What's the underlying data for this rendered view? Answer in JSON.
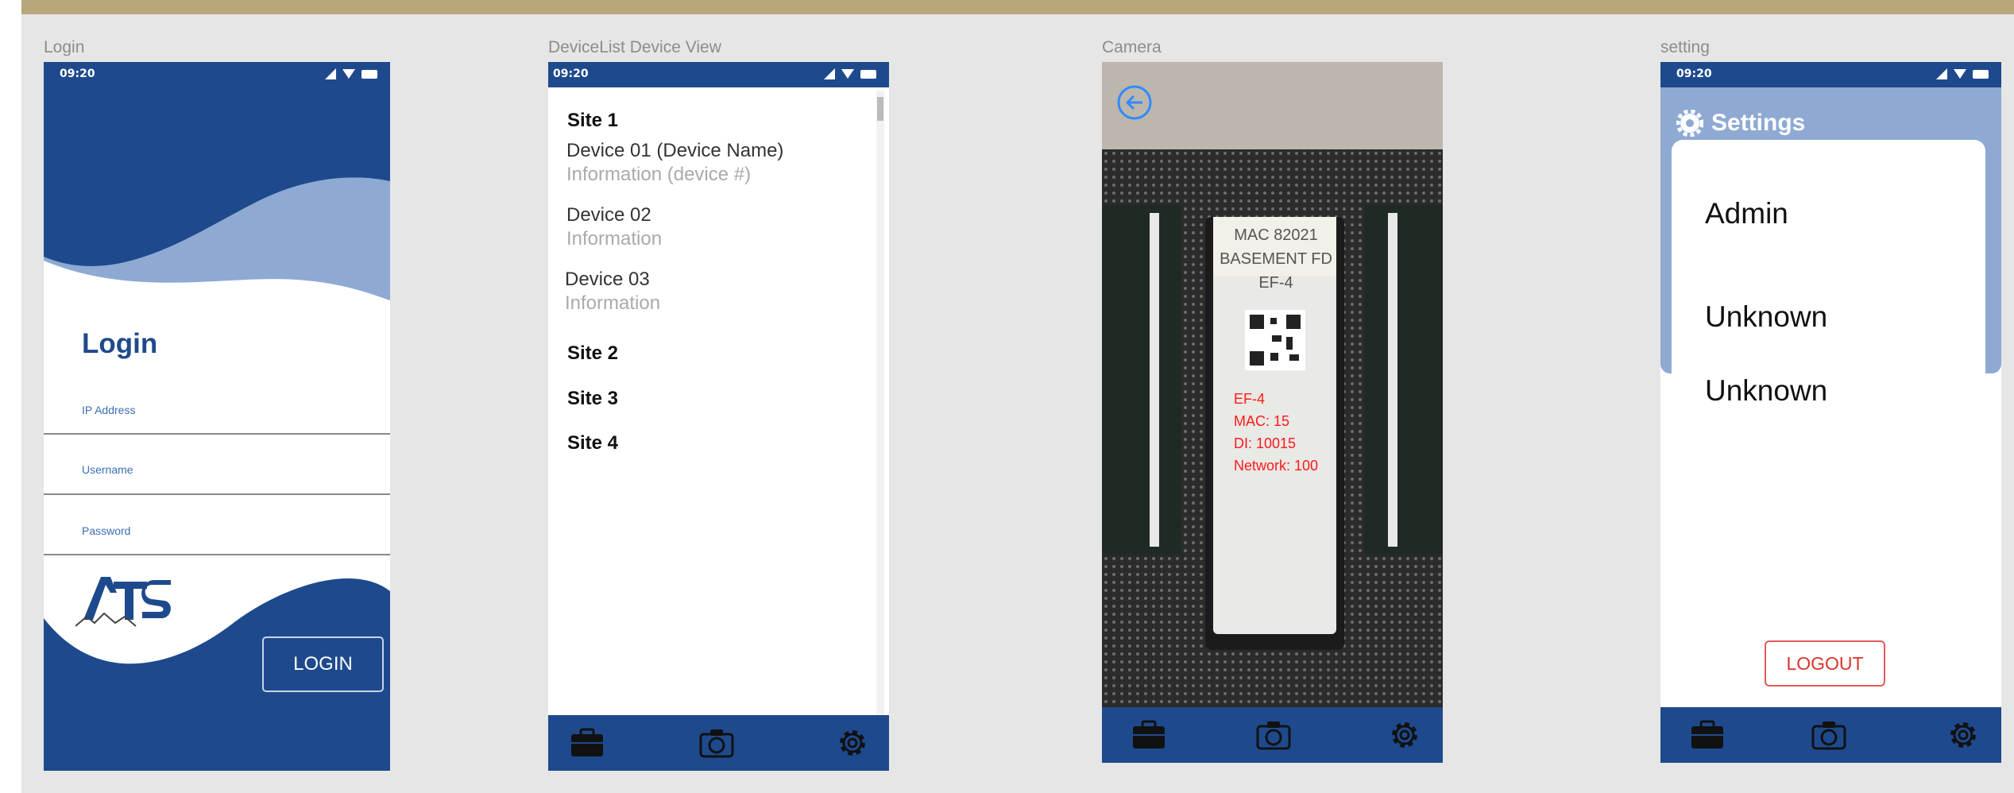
{
  "frames": {
    "login": "Login",
    "devicelist": "DeviceList Device View",
    "camera": "Camera",
    "setting": "setting"
  },
  "status": {
    "time": "09:20"
  },
  "login": {
    "title": "Login",
    "ip_label": "IP Address",
    "username_label": "Username",
    "password_label": "Password",
    "button": "LOGIN",
    "logo_text": "ATS"
  },
  "devicelist": {
    "site1": "Site 1",
    "devices": [
      {
        "name": "Device 01 (Device Name)",
        "info": "Information (device #)"
      },
      {
        "name": "Device 02",
        "info": "Information"
      },
      {
        "name": "Device 03",
        "info": "Information"
      }
    ],
    "site2": "Site 2",
    "site3": "Site 3",
    "site4": "Site 4"
  },
  "camera": {
    "label_lines": [
      "MAC 82021",
      "BASEMENT FD",
      "EF-4"
    ],
    "overlay": [
      "EF-4",
      "MAC: 15",
      "DI: 10015",
      "Network: 100"
    ]
  },
  "settings": {
    "title": "Settings",
    "items": [
      "Admin",
      "Unknown",
      "Unknown"
    ],
    "logout": "LOGOUT"
  },
  "icons": {
    "nav": [
      "briefcase-icon",
      "camera-icon",
      "gear-icon"
    ],
    "status": [
      "signal-icon",
      "wifi-icon",
      "battery-icon"
    ]
  },
  "colors": {
    "brand_blue": "#1e4a8d",
    "light_blue": "#8eaad3",
    "link_blue": "#3a6fb5",
    "logout_red": "#d9342b",
    "overlay_red": "#ff1a1a",
    "top_bar": "#b8a77a"
  }
}
